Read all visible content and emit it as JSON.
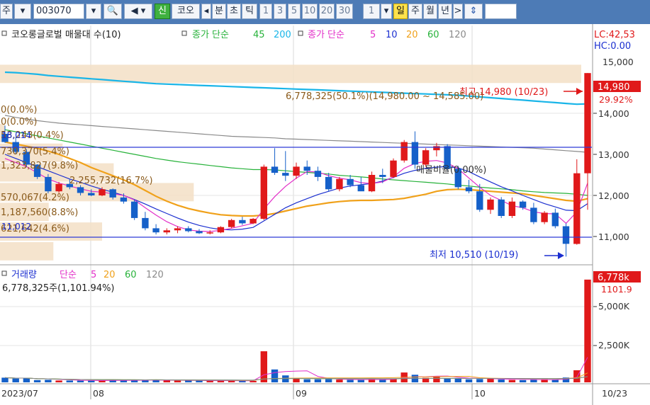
{
  "toolbar": {
    "period_unit": "주",
    "stock_code": "003070",
    "sin_badge": "신",
    "stock_name_partial": "코오",
    "prev_arrow": "◂",
    "tf_minute": "분",
    "tf_second": "초",
    "tf_tick": "틱",
    "intervals": [
      "1",
      "3",
      "5",
      "10",
      "20",
      "30"
    ],
    "count_value": "1",
    "tf_day": "일",
    "tf_week": "주",
    "tf_month": "월",
    "tf_year": "년",
    "next_arrow": ">",
    "updown_glyph": "⇕"
  },
  "legend": {
    "price_item": "코오롱글로벌 매물대 수(10)",
    "ma_close_simple": "종가 단순",
    "ma_close_a": "45",
    "ma_close_b": "200",
    "ma2_label": "종가 단순",
    "ma2_periods": [
      "5",
      "10",
      "20",
      "60",
      "120"
    ]
  },
  "top_right": {
    "lc": "LC:42,53",
    "hc": "HC:0.00"
  },
  "annotations": {
    "high": "최고 14,980 (10/23)",
    "low": "최저 10,510 (10/19)",
    "volume_ratio": "6,778,325(50.1%)(14,980.00 ~ 14,585.00)",
    "vp_rows": [
      "0(0.0%)",
      "0(0.0%)",
      "53,243(0.4%)",
      "730,370(5.4%)",
      "1,323,827(9.8%)",
      "2,255,732(16.7%)",
      "570,067(4.2%)",
      "1,187,560(8.8%)",
      "621,642(4.6%)"
    ],
    "vp_tag_mid": "18,014",
    "vp_tag_low": "11,012",
    "maemul": "매물비율(0.00%)"
  },
  "price_axis": {
    "current_label": "14,980",
    "pct_label": "29.92%",
    "ticks": [
      "14,000",
      "13,000",
      "12,000",
      "11,000"
    ],
    "cut_top": "15,000"
  },
  "volume_legend": {
    "title": "거래량",
    "ma_label": "단순",
    "periods": [
      "5",
      "20",
      "60",
      "120"
    ],
    "value_line": "6,778,325주(1,101.94%)"
  },
  "volume_axis": {
    "current_label": "6,778k",
    "pct_label": "1101.9",
    "ticks": [
      "5,000K",
      "2,500K"
    ]
  },
  "date_axis": {
    "labels": [
      "2023/07",
      "08",
      "09",
      "10"
    ],
    "last": "10/23"
  },
  "colors": {
    "up": "#e0191a",
    "down": "#1560c9",
    "ma5": "#e22fc8",
    "ma10": "#1b2fd0",
    "ma20": "#f0a11a",
    "ma60": "#27b23a",
    "ma120": "#8a8a8a",
    "ma45": "#19b5e8",
    "band": "#f3dfc6",
    "annotation": "#8a5a1a"
  },
  "chart_data": {
    "type": "candlestick",
    "title": "코오롱글로벌",
    "ylim": [
      10400,
      15200
    ],
    "volume_ylim": [
      0,
      6900000
    ],
    "dates": [
      "07/31",
      "08/01",
      "08/02",
      "08/03",
      "08/04",
      "08/07",
      "08/08",
      "08/09",
      "08/10",
      "08/11",
      "08/14",
      "08/16",
      "08/17",
      "08/18",
      "08/21",
      "08/22",
      "08/23",
      "08/24",
      "08/25",
      "08/28",
      "08/29",
      "08/30",
      "08/31",
      "09/01",
      "09/04",
      "09/05",
      "09/06",
      "09/07",
      "09/08",
      "09/11",
      "09/12",
      "09/13",
      "09/14",
      "09/15",
      "09/18",
      "09/19",
      "09/20",
      "09/21",
      "09/22",
      "09/25",
      "09/26",
      "09/27",
      "10/04",
      "10/05",
      "10/06",
      "10/10",
      "10/11",
      "10/12",
      "10/13",
      "10/16",
      "10/17",
      "10/18",
      "10/19",
      "10/20",
      "10/23"
    ],
    "candles": [
      [
        13500,
        13700,
        13280,
        13300
      ],
      [
        13300,
        13420,
        13000,
        13060
      ],
      [
        13060,
        13120,
        12700,
        12750
      ],
      [
        12750,
        12760,
        12400,
        12450
      ],
      [
        12450,
        12520,
        12050,
        12100
      ],
      [
        12100,
        12330,
        12060,
        12280
      ],
      [
        12280,
        12400,
        12150,
        12200
      ],
      [
        12200,
        12250,
        12000,
        12060
      ],
      [
        12060,
        12150,
        11980,
        12000
      ],
      [
        12000,
        12200,
        11980,
        12150
      ],
      [
        12150,
        12170,
        11900,
        11950
      ],
      [
        11950,
        12050,
        11800,
        11850
      ],
      [
        11850,
        11900,
        11400,
        11450
      ],
      [
        11450,
        11600,
        11150,
        11200
      ],
      [
        11200,
        11300,
        11050,
        11100
      ],
      [
        11100,
        11200,
        11050,
        11150
      ],
      [
        11150,
        11250,
        11080,
        11200
      ],
      [
        11200,
        11250,
        11100,
        11130
      ],
      [
        11130,
        11180,
        11060,
        11080
      ],
      [
        11080,
        11150,
        11050,
        11100
      ],
      [
        11100,
        11250,
        11080,
        11230
      ],
      [
        11230,
        11430,
        11200,
        11400
      ],
      [
        11400,
        11480,
        11280,
        11320
      ],
      [
        11320,
        11450,
        11300,
        11430
      ],
      [
        11430,
        12750,
        11400,
        12700
      ],
      [
        12700,
        13150,
        12500,
        12550
      ],
      [
        12550,
        13080,
        12350,
        12480
      ],
      [
        12480,
        12800,
        12400,
        12700
      ],
      [
        12700,
        12850,
        12500,
        12600
      ],
      [
        12600,
        12700,
        12350,
        12450
      ],
      [
        12450,
        12550,
        12100,
        12150
      ],
      [
        12150,
        12450,
        12100,
        12400
      ],
      [
        12400,
        12500,
        12200,
        12250
      ],
      [
        12250,
        12450,
        12150,
        12100
      ],
      [
        12100,
        12580,
        12080,
        12500
      ],
      [
        12500,
        12650,
        12300,
        12450
      ],
      [
        12450,
        12900,
        12420,
        12850
      ],
      [
        12850,
        13350,
        12800,
        13300
      ],
      [
        13300,
        13560,
        12650,
        12750
      ],
      [
        12750,
        13150,
        12700,
        13100
      ],
      [
        13100,
        13280,
        12950,
        13200
      ],
      [
        13200,
        13250,
        12600,
        12650
      ],
      [
        12650,
        12720,
        12150,
        12200
      ],
      [
        12200,
        12380,
        12050,
        12100
      ],
      [
        12100,
        12280,
        11600,
        11650
      ],
      [
        11650,
        11950,
        11550,
        11900
      ],
      [
        11900,
        11960,
        11450,
        11500
      ],
      [
        11500,
        11950,
        11450,
        11850
      ],
      [
        11850,
        11880,
        11650,
        11700
      ],
      [
        11700,
        11820,
        11300,
        11350
      ],
      [
        11350,
        11620,
        11300,
        11580
      ],
      [
        11580,
        11680,
        11200,
        11250
      ],
      [
        11250,
        11320,
        10510,
        10820
      ],
      [
        10820,
        12880,
        10800,
        12540
      ],
      [
        12540,
        14980,
        11650,
        14980
      ]
    ],
    "volume": [
      310000,
      250000,
      280000,
      150000,
      170000,
      120000,
      120000,
      110000,
      110000,
      130000,
      160000,
      120000,
      150000,
      140000,
      170000,
      120000,
      110000,
      120000,
      110000,
      110000,
      110000,
      110000,
      100000,
      100000,
      2050000,
      850000,
      460000,
      250000,
      200000,
      200000,
      210000,
      180000,
      170000,
      160000,
      220000,
      190000,
      230000,
      650000,
      500000,
      300000,
      360000,
      280000,
      260000,
      200000,
      220000,
      260000,
      190000,
      160000,
      150000,
      180000,
      200000,
      170000,
      320000,
      800000,
      6778325
    ],
    "ma_series": [
      {
        "name": "45",
        "values": [
          15000,
          14990,
          14970,
          14950,
          14920,
          14900,
          14880,
          14860,
          14840,
          14820,
          14800,
          14780,
          14760,
          14740,
          14720,
          14710,
          14700,
          14690,
          14680,
          14670,
          14660,
          14650,
          14640,
          14630,
          14620,
          14610,
          14600,
          14590,
          14580,
          14570,
          14560,
          14550,
          14540,
          14530,
          14520,
          14510,
          14500,
          14490,
          14480,
          14470,
          14460,
          14450,
          14440,
          14420,
          14400,
          14380,
          14360,
          14340,
          14320,
          14300,
          14280,
          14260,
          14240,
          14220,
          14230
        ]
      },
      {
        "name": "120",
        "values": [
          13950,
          13900,
          13860,
          13820,
          13790,
          13760,
          13740,
          13720,
          13700,
          13680,
          13660,
          13640,
          13620,
          13600,
          13580,
          13560,
          13540,
          13520,
          13500,
          13480,
          13460,
          13440,
          13430,
          13420,
          13410,
          13400,
          13380,
          13370,
          13360,
          13350,
          13340,
          13330,
          13320,
          13310,
          13300,
          13290,
          13280,
          13270,
          13260,
          13250,
          13240,
          13230,
          13220,
          13210,
          13200,
          13190,
          13180,
          13170,
          13160,
          13150,
          13130,
          13110,
          13090,
          13070,
          13050
        ]
      },
      {
        "name": "60",
        "values": [
          13600,
          13550,
          13500,
          13450,
          13400,
          13350,
          13300,
          13250,
          13200,
          13150,
          13100,
          13050,
          13000,
          12950,
          12900,
          12860,
          12820,
          12790,
          12760,
          12730,
          12700,
          12670,
          12650,
          12630,
          12630,
          12620,
          12600,
          12580,
          12560,
          12540,
          12520,
          12490,
          12470,
          12450,
          12430,
          12400,
          12380,
          12360,
          12340,
          12320,
          12300,
          12280,
          12250,
          12230,
          12200,
          12180,
          12160,
          12140,
          12110,
          12090,
          12070,
          12060,
          12050,
          12030,
          12000
        ]
      },
      {
        "name": "20",
        "values": [
          13300,
          13250,
          13200,
          13150,
          13080,
          13000,
          12900,
          12800,
          12680,
          12580,
          12480,
          12380,
          12260,
          12120,
          11980,
          11860,
          11760,
          11680,
          11620,
          11570,
          11530,
          11510,
          11500,
          11500,
          11520,
          11560,
          11620,
          11680,
          11740,
          11780,
          11820,
          11850,
          11870,
          11880,
          11880,
          11890,
          11900,
          11930,
          11980,
          12030,
          12100,
          12140,
          12150,
          12140,
          12120,
          12100,
          12080,
          12060,
          12040,
          12000,
          11960,
          11920,
          11880,
          11860,
          11920
        ]
      },
      {
        "name": "10",
        "values": [
          13000,
          12900,
          12800,
          12700,
          12600,
          12500,
          12400,
          12320,
          12230,
          12150,
          12080,
          12000,
          11900,
          11790,
          11670,
          11560,
          11450,
          11350,
          11270,
          11210,
          11170,
          11160,
          11180,
          11220,
          11380,
          11540,
          11700,
          11820,
          11920,
          12020,
          12100,
          12180,
          12230,
          12260,
          12290,
          12350,
          12440,
          12540,
          12610,
          12660,
          12690,
          12700,
          12670,
          12580,
          12450,
          12330,
          12210,
          12110,
          12000,
          11900,
          11800,
          11720,
          11640,
          11630,
          11800
        ]
      },
      {
        "name": "5",
        "values": [
          12900,
          12800,
          12700,
          12550,
          12400,
          12300,
          12230,
          12160,
          12100,
          12080,
          12040,
          12000,
          11890,
          11700,
          11520,
          11360,
          11240,
          11160,
          11130,
          11120,
          11150,
          11200,
          11260,
          11320,
          11670,
          11970,
          12220,
          12420,
          12580,
          12570,
          12480,
          12420,
          12380,
          12310,
          12290,
          12330,
          12450,
          12660,
          12780,
          12830,
          12850,
          12790,
          12650,
          12420,
          12200,
          12000,
          11880,
          11750,
          11700,
          11600,
          11560,
          11550,
          11320,
          11600,
          12300
        ]
      }
    ],
    "volume_profile": {
      "price_bins": [
        [
          15200,
          14720
        ],
        [
          14720,
          14240
        ],
        [
          14240,
          13760
        ],
        [
          13760,
          13280
        ],
        [
          13280,
          12800
        ],
        [
          12800,
          12320
        ],
        [
          12320,
          11840
        ],
        [
          11840,
          11360
        ],
        [
          11360,
          10880
        ],
        [
          10880,
          10400
        ]
      ],
      "pct": [
        50.1,
        0.0,
        0.0,
        0.4,
        5.4,
        9.8,
        16.7,
        4.2,
        8.8,
        4.6
      ]
    }
  }
}
